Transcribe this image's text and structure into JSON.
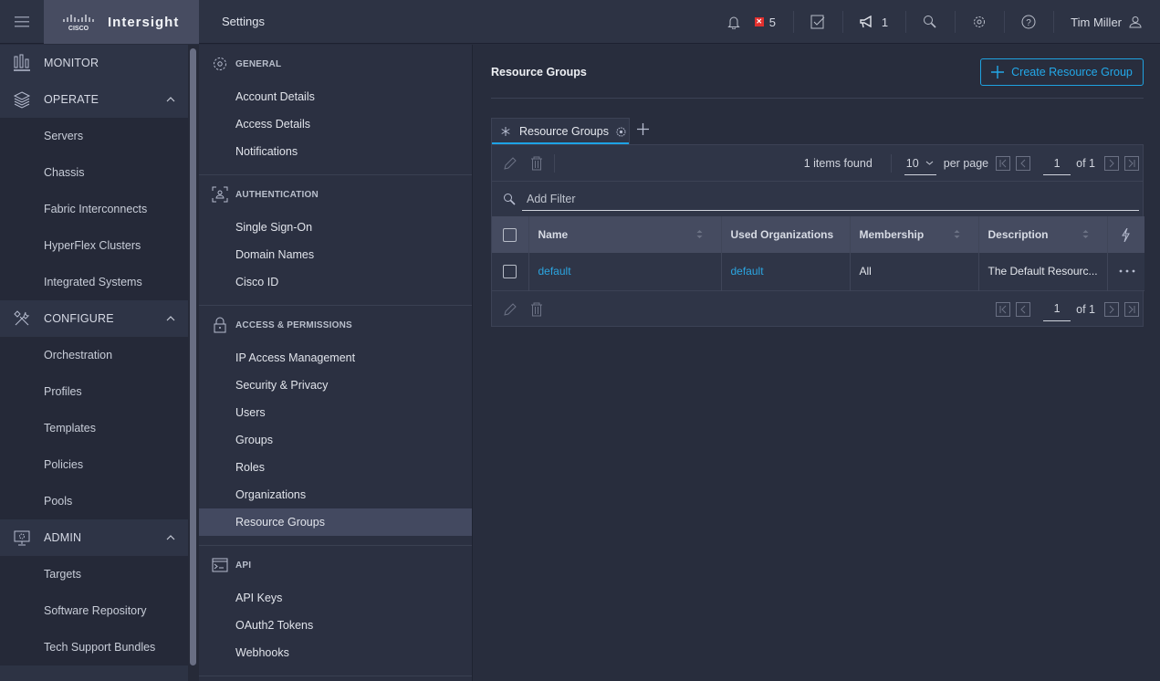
{
  "app": {
    "brand_logo": "cisco",
    "brand_name": "Intersight",
    "page_label": "Settings"
  },
  "topbar": {
    "alarm_count": "5",
    "announcement_count": "1",
    "user_name": "Tim Miller"
  },
  "leftnav": {
    "sections": [
      {
        "label": "MONITOR",
        "icon": "chart-bar-icon",
        "items": []
      },
      {
        "label": "OPERATE",
        "icon": "layers-icon",
        "expanded": true,
        "items": [
          "Servers",
          "Chassis",
          "Fabric Interconnects",
          "HyperFlex Clusters",
          "Integrated Systems"
        ]
      },
      {
        "label": "CONFIGURE",
        "icon": "tools-icon",
        "expanded": true,
        "items": [
          "Orchestration",
          "Profiles",
          "Templates",
          "Policies",
          "Pools"
        ]
      },
      {
        "label": "ADMIN",
        "icon": "monitor-gear-icon",
        "expanded": true,
        "items": [
          "Targets",
          "Software Repository",
          "Tech Support Bundles"
        ]
      }
    ]
  },
  "settingsnav": {
    "groups": [
      {
        "label": "GENERAL",
        "items": [
          "Account Details",
          "Access Details",
          "Notifications"
        ]
      },
      {
        "label": "AUTHENTICATION",
        "items": [
          "Single Sign-On",
          "Domain Names",
          "Cisco ID"
        ]
      },
      {
        "label": "ACCESS & PERMISSIONS",
        "items": [
          "IP Access Management",
          "Security & Privacy",
          "Users",
          "Groups",
          "Roles",
          "Organizations",
          "Resource Groups"
        ]
      },
      {
        "label": "API",
        "items": [
          "API Keys",
          "OAuth2 Tokens",
          "Webhooks"
        ]
      }
    ],
    "active_item": "Resource Groups"
  },
  "main": {
    "title": "Resource Groups",
    "create_button": "Create Resource Group",
    "tab_label": "Resource Groups",
    "items_found": "1 items found",
    "page_size": "10",
    "per_page_label": "per page",
    "page_number": "1",
    "page_of": "of 1",
    "filter_placeholder": "Add Filter",
    "columns": [
      "Name",
      "Used Organizations",
      "Membership",
      "Description"
    ],
    "rows": [
      {
        "name": "default",
        "used_organizations": "default",
        "membership": "All",
        "description": "The Default Resourc..."
      }
    ]
  },
  "colors": {
    "accent": "#1ea3e6",
    "alarm": "#e2302e",
    "active_nav": "#434960"
  }
}
